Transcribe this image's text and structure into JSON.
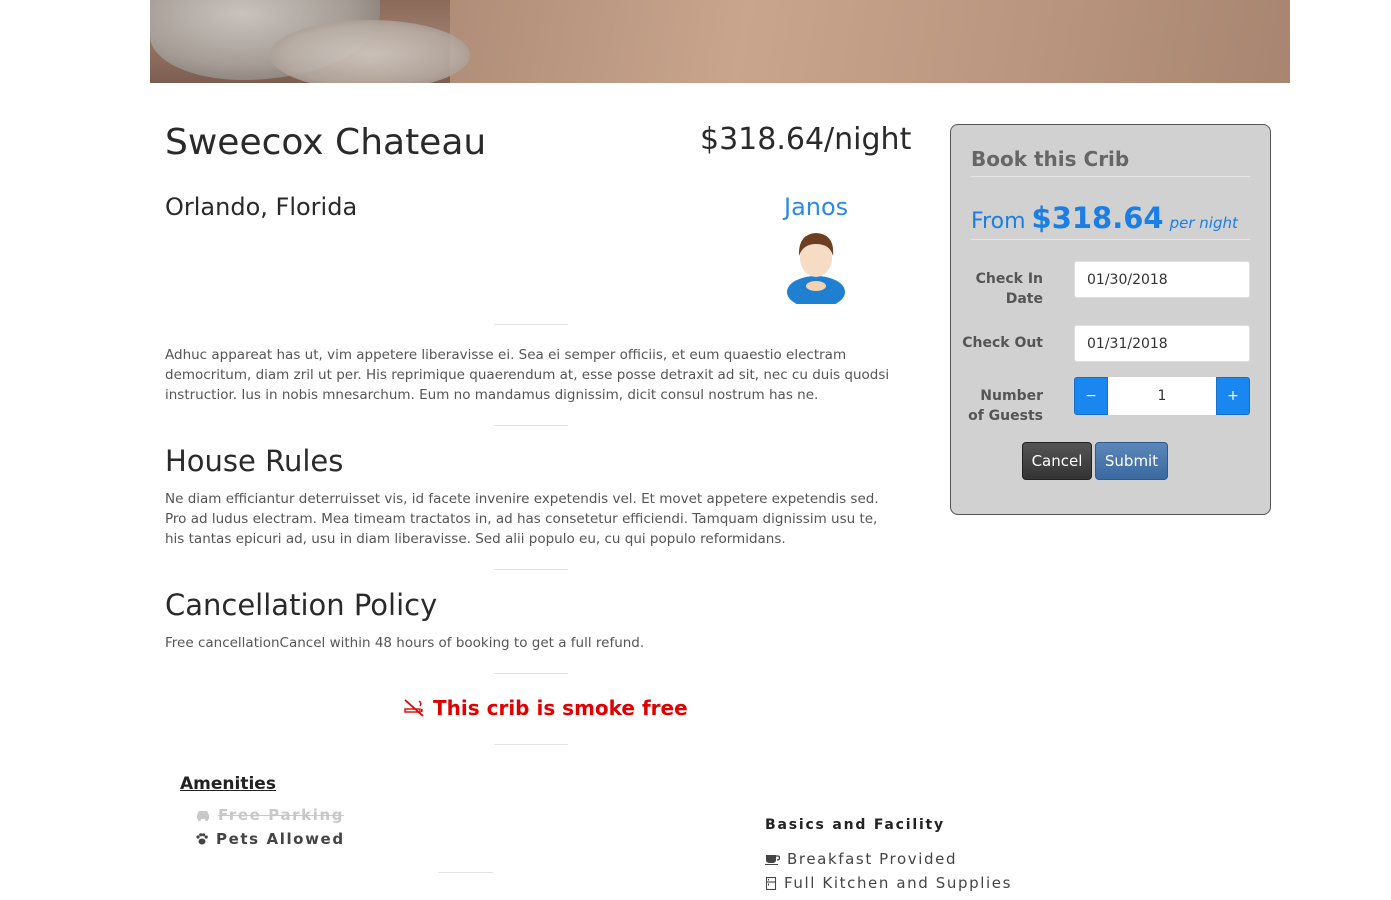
{
  "listing": {
    "title": "Sweecox Chateau",
    "price_top": "$318.64/night",
    "location": "Orlando, Florida",
    "host_name": "Janos",
    "description": "Adhuc appareat has ut, vim appetere liberavisse ei. Sea ei semper officiis, et eum quaestio electram democritum, diam zril ut per. His reprimique quaerendum at, esse posse detraxit ad sit, nec cu duis quodsi instructior. Ius in nobis mnesarchum. Eum no mandamus dignissim, dicit consul nostrum has ne."
  },
  "rules": {
    "heading": "House Rules",
    "text": "Ne diam efficiantur deterruisset vis, id facete invenire expetendis vel. Et movet appetere expetendis sed. Pro ad ludus electram. Mea timeam tractatos in, ad has consetetur efficiendi. Tamquam dignissim usu te, his tantas epicuri ad, usu in diam liberavisse. Sed alii populo eu, cu qui populo reformidans."
  },
  "cancellation": {
    "heading": "Cancellation Policy",
    "text": "Free cancellationCancel within 48 hours of booking to get a full refund."
  },
  "smoke": {
    "text": "This crib is smoke free",
    "icon": "no-smoking-icon",
    "color": "#e00000"
  },
  "amenities": {
    "title": "Amenities",
    "items": [
      {
        "label": "Free Parking",
        "icon": "car-icon",
        "available": false
      },
      {
        "label": "Pets Allowed",
        "icon": "paw-icon",
        "available": true
      }
    ],
    "basics_title": "Basics and Facility",
    "basics": [
      {
        "label": "Breakfast Provided",
        "icon": "coffee-icon"
      },
      {
        "label": "Full Kitchen and Supplies",
        "icon": "kitchen-icon"
      }
    ]
  },
  "booking": {
    "title": "Book this Crib",
    "from_label": "From",
    "amount": "$318.64",
    "per": "per night",
    "checkin_label_1": "Check In",
    "checkin_label_2": "Date",
    "checkin_value": "01/30/2018",
    "checkout_label": "Check Out",
    "checkout_value": "01/31/2018",
    "guests_label_1": "Number",
    "guests_label_2": "of Guests",
    "guests_value": "1",
    "minus": "−",
    "plus": "+",
    "cancel_label": "Cancel",
    "submit_label": "Submit",
    "accent": "#1a7ee6"
  }
}
